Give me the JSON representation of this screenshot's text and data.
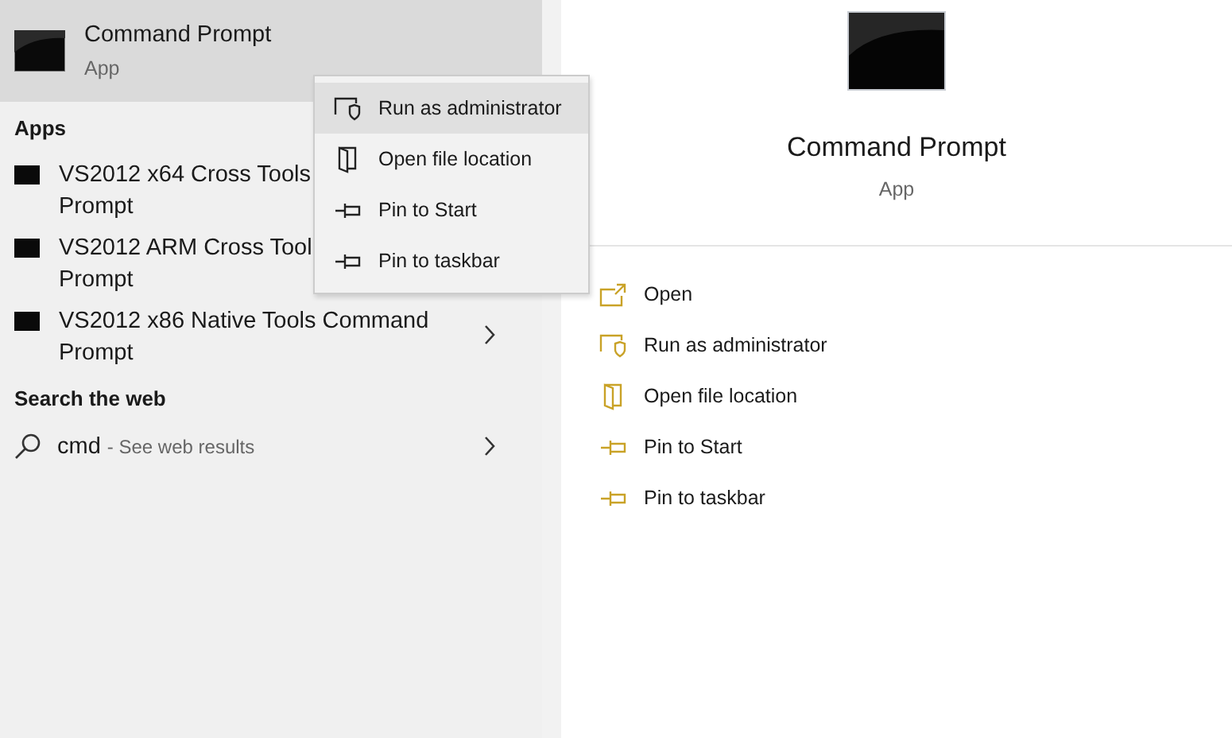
{
  "best_match": {
    "title": "Command Prompt",
    "subtitle": "App",
    "selected": true
  },
  "apps_heading": "Apps",
  "apps": [
    {
      "lines": [
        "VS2012 x64 Cross Tools",
        "Prompt"
      ]
    },
    {
      "lines": [
        "VS2012 ARM Cross Tool",
        "Prompt"
      ]
    },
    {
      "lines": [
        "VS2012 x86 Native Tools Command",
        "Prompt"
      ],
      "chevron": true
    }
  ],
  "web_heading": "Search the web",
  "web_result": {
    "query": "cmd",
    "hint": "- See web results"
  },
  "context_menu": [
    {
      "label": "Run as administrator",
      "kind": "shield",
      "selected": true
    },
    {
      "label": "Open file location",
      "kind": "folder",
      "selected": false
    },
    {
      "label": "Pin to Start",
      "kind": "pin",
      "selected": false
    },
    {
      "label": "Pin to taskbar",
      "kind": "pin",
      "selected": false
    }
  ],
  "detail": {
    "title": "Command Prompt",
    "subtitle": "App"
  },
  "actions": [
    {
      "label": "Open",
      "kind": "open"
    },
    {
      "label": "Run as administrator",
      "kind": "shield"
    },
    {
      "label": "Open file location",
      "kind": "folder"
    },
    {
      "label": "Pin to Start",
      "kind": "pin"
    },
    {
      "label": "Pin to taskbar",
      "kind": "pin"
    }
  ]
}
